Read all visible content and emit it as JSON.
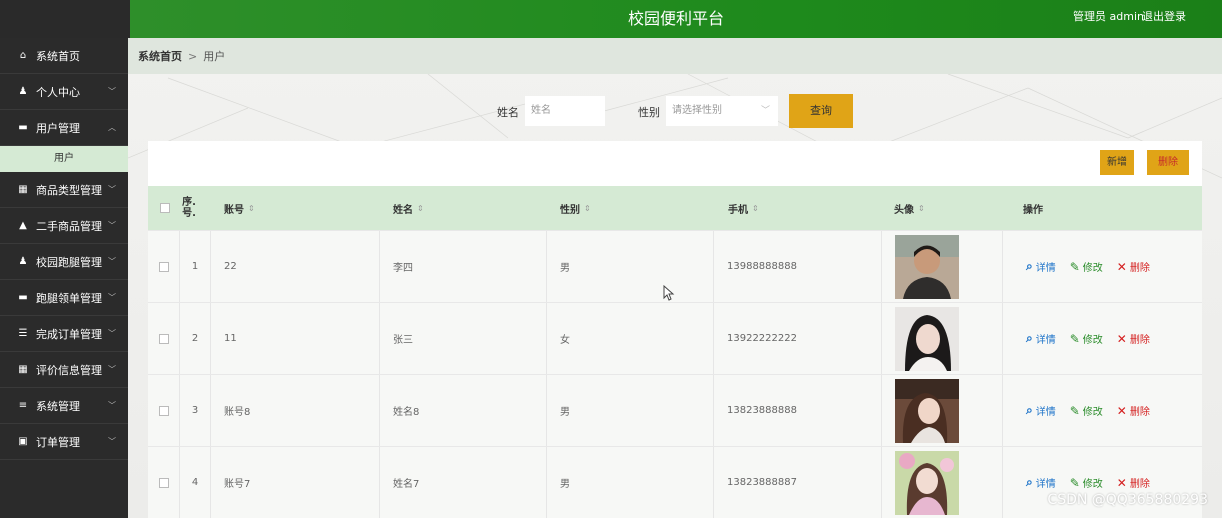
{
  "header": {
    "title": "校园便利平台",
    "user_text": "管理员 admin",
    "logout": "退出登录"
  },
  "sidebar": {
    "items": [
      {
        "label": "系统首页",
        "icon": "home-icon",
        "glyph": "⌂",
        "chevron": ""
      },
      {
        "label": "个人中心",
        "icon": "user-icon",
        "glyph": "♟",
        "chevron": "﹀"
      },
      {
        "label": "用户管理",
        "icon": "monitor-icon",
        "glyph": "▬",
        "chevron": "︿"
      },
      {
        "label": "商品类型管理",
        "icon": "grid-icon",
        "glyph": "▦",
        "chevron": "﹀"
      },
      {
        "label": "二手商品管理",
        "icon": "briefcase-icon",
        "glyph": "▲",
        "chevron": "﹀"
      },
      {
        "label": "校园跑腿管理",
        "icon": "user-icon",
        "glyph": "♟",
        "chevron": "﹀"
      },
      {
        "label": "跑腿领单管理",
        "icon": "monitor-icon",
        "glyph": "▬",
        "chevron": "﹀"
      },
      {
        "label": "完成订单管理",
        "icon": "sliders-icon",
        "glyph": "☰",
        "chevron": "﹀"
      },
      {
        "label": "评价信息管理",
        "icon": "grid-icon",
        "glyph": "▦",
        "chevron": "﹀"
      },
      {
        "label": "系统管理",
        "icon": "list-icon",
        "glyph": "≡",
        "chevron": "﹀"
      },
      {
        "label": "订单管理",
        "icon": "clipboard-icon",
        "glyph": "▣",
        "chevron": "﹀"
      }
    ],
    "subitem": "用户"
  },
  "breadcrumb": {
    "home": "系统首页",
    "sep": ">",
    "current": "用户"
  },
  "search": {
    "name_label": "姓名",
    "name_placeholder": "姓名",
    "gender_label": "性别",
    "gender_placeholder": "请选择性别",
    "query_button": "查询"
  },
  "toolbar": {
    "add": "新增",
    "delete": "删除"
  },
  "table": {
    "headers": {
      "index": "序.号.",
      "account": "账号",
      "name": "姓名",
      "gender": "性别",
      "phone": "手机",
      "avatar": "头像",
      "actions": "操作"
    },
    "sort_glyph": "⇕",
    "rows": [
      {
        "index": "1",
        "account": "22",
        "name": "李四",
        "gender": "男",
        "phone": "13988888888"
      },
      {
        "index": "2",
        "account": "11",
        "name": "张三",
        "gender": "女",
        "phone": "13922222222"
      },
      {
        "index": "3",
        "account": "账号8",
        "name": "姓名8",
        "gender": "男",
        "phone": "13823888888"
      },
      {
        "index": "4",
        "account": "账号7",
        "name": "姓名7",
        "gender": "男",
        "phone": "13823888887"
      }
    ],
    "actions": {
      "detail": "详情",
      "edit": "修改",
      "remove": "删除"
    }
  },
  "colors": {
    "header_green": "#1e8a1c",
    "sidebar_bg": "#2b2b2b",
    "accent_gold": "#e0a417",
    "table_header": "#d5ead4",
    "danger": "#d41f1f",
    "link_blue": "#1e74c9"
  },
  "watermark": "CSDN @QQ365880293"
}
